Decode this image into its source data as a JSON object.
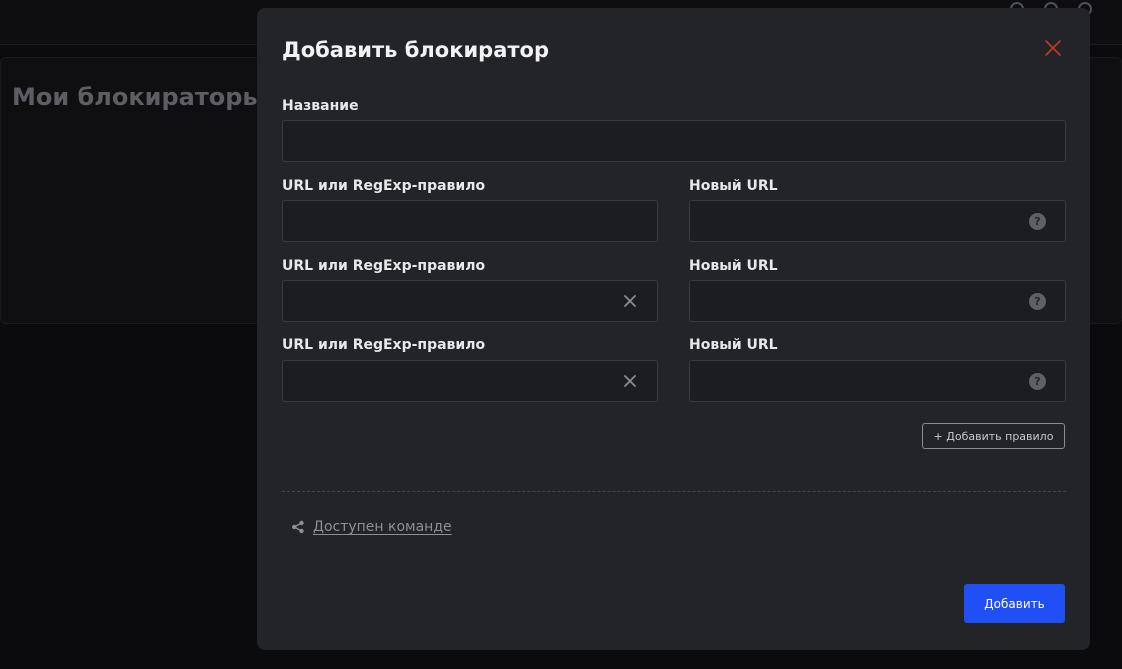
{
  "background": {
    "page_title": "Мои блокираторы"
  },
  "modal": {
    "title": "Добавить блокиратор",
    "name_label": "Название",
    "name_value": "",
    "rules": [
      {
        "url_label": "URL или RegExp-правило",
        "url_value": "",
        "new_url_label": "Новый URL",
        "new_url_value": "",
        "removable": false
      },
      {
        "url_label": "URL или RegExp-правило",
        "url_value": "",
        "new_url_label": "Новый URL",
        "new_url_value": "",
        "removable": true
      },
      {
        "url_label": "URL или RegExp-правило",
        "url_value": "",
        "new_url_label": "Новый URL",
        "new_url_value": "",
        "removable": true
      }
    ],
    "help_glyph": "?",
    "add_rule_label": "+ Добавить правило",
    "share_link": "Доступен команде",
    "submit_label": "Добавить"
  },
  "colors": {
    "accent": "#1f4ff5",
    "close": "#c0392b",
    "modal_bg": "#232428",
    "page_bg": "#0b0b0d"
  }
}
